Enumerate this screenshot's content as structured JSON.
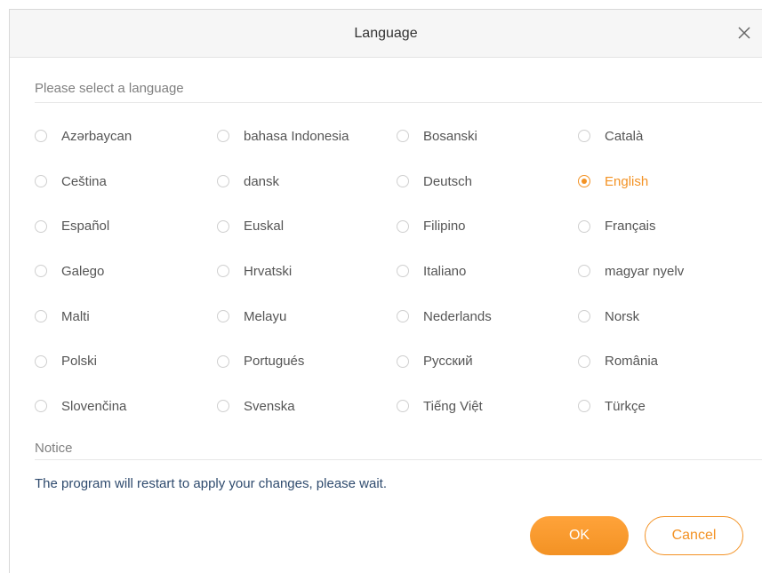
{
  "dialog": {
    "title": "Language",
    "close_icon": "close-icon",
    "select_label": "Please select a language",
    "languages": [
      "Azərbaycan",
      "bahasa Indonesia",
      "Bosanski",
      "Català",
      "Ceština",
      "dansk",
      "Deutsch",
      "English",
      "Español",
      "Euskal",
      "Filipino",
      "Français",
      "Galego",
      "Hrvatski",
      "Italiano",
      "magyar nyelv",
      "Malti",
      "Melayu",
      "Nederlands",
      "Norsk",
      "Polski",
      "Portugués",
      "Русский",
      "România",
      "Slovenčina",
      "Svenska",
      "Tiếng Việt",
      "Türkçe"
    ],
    "selected_language": "English",
    "notice_label": "Notice",
    "notice_text": "The program will restart to apply your changes, please wait.",
    "ok_label": "OK",
    "cancel_label": "Cancel"
  },
  "colors": {
    "accent": "#f39224",
    "notice_text": "#2f4b6e",
    "label_gray": "#808080"
  }
}
